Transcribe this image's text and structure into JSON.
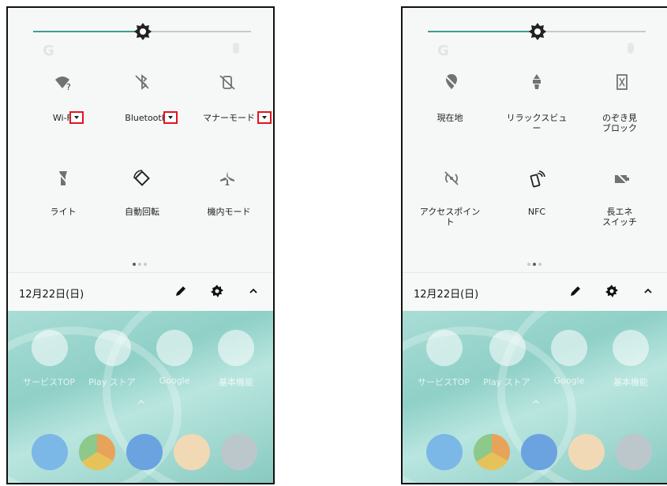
{
  "screens": [
    {
      "tiles": [
        {
          "label": "Wi-Fi",
          "icon": "wifi-unknown-icon",
          "dropdown": true
        },
        {
          "label": "Bluetooth",
          "icon": "bluetooth-off-icon",
          "dropdown": true
        },
        {
          "label": "マナーモード",
          "icon": "manner-mode-off-icon",
          "dropdown": true
        },
        {
          "label": "ライト",
          "icon": "flashlight-off-icon",
          "dropdown": false
        },
        {
          "label": "自動回転",
          "icon": "auto-rotate-icon",
          "dropdown": false
        },
        {
          "label": "機内モード",
          "icon": "airplane-mode-off-icon",
          "dropdown": false
        }
      ],
      "active_page": 0,
      "date": "12月22日(日)"
    },
    {
      "tiles": [
        {
          "label": "現在地",
          "icon": "location-off-icon",
          "dropdown": false
        },
        {
          "label": "リラックスビュ\nー",
          "icon": "relax-view-icon",
          "dropdown": false
        },
        {
          "label": "のぞき見\nブロック",
          "icon": "peek-block-icon",
          "dropdown": false
        },
        {
          "label": "アクセスポイン\nト",
          "icon": "hotspot-off-icon",
          "dropdown": false
        },
        {
          "label": "NFC",
          "icon": "nfc-icon",
          "dropdown": false
        },
        {
          "label": "長エネ\nスイッチ",
          "icon": "battery-saver-icon",
          "dropdown": false
        }
      ],
      "active_page": 1,
      "date": "12月22日(日)"
    }
  ],
  "home": {
    "apps": [
      "サービスTOP",
      "Play ストア",
      "Google",
      "基本機能"
    ]
  },
  "colors": {
    "accent": "#3d9d8e",
    "highlight_box": "#e3141f"
  }
}
